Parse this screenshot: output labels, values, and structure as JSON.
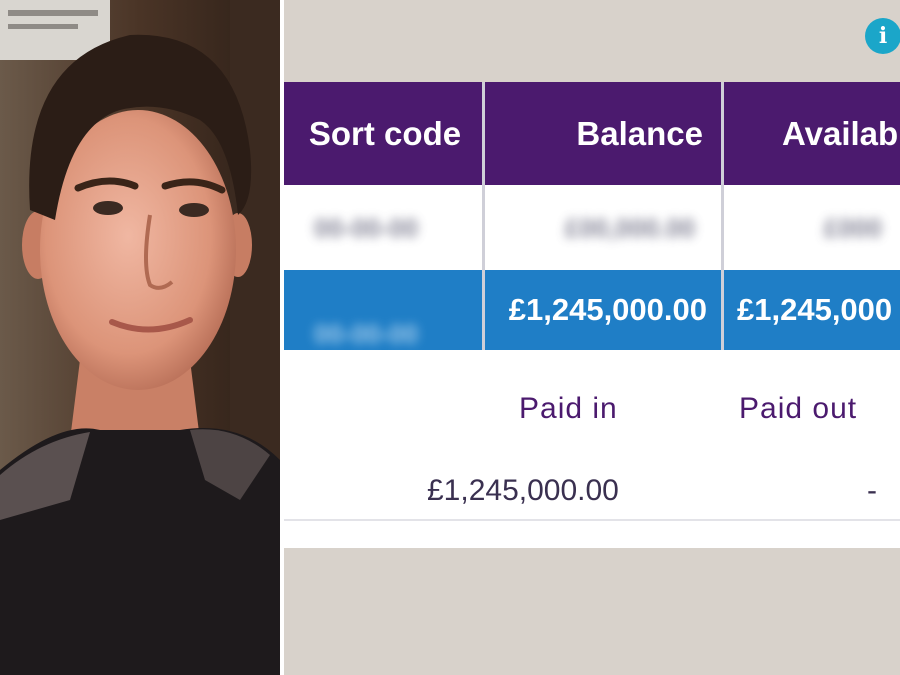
{
  "table": {
    "headers": {
      "sort_code": "Sort code",
      "balance": "Balance",
      "available": "Availab"
    },
    "rows": [
      {
        "sort_code": "00-00-00",
        "balance": "£00,000.00",
        "available": "£000"
      },
      {
        "sort_code": "00-00-00",
        "balance": "£1,245,000.00",
        "available": "£1,245,000"
      }
    ]
  },
  "transaction": {
    "paid_in_label": "Paid in",
    "paid_out_label": "Paid out",
    "paid_in_value": "£1,245,000.00",
    "paid_out_value": "-"
  },
  "icons": {
    "info": "info-icon"
  },
  "colors": {
    "header_purple": "#4b1a6e",
    "highlight_blue": "#1f7ec6",
    "info_teal": "#1ba6c9"
  }
}
